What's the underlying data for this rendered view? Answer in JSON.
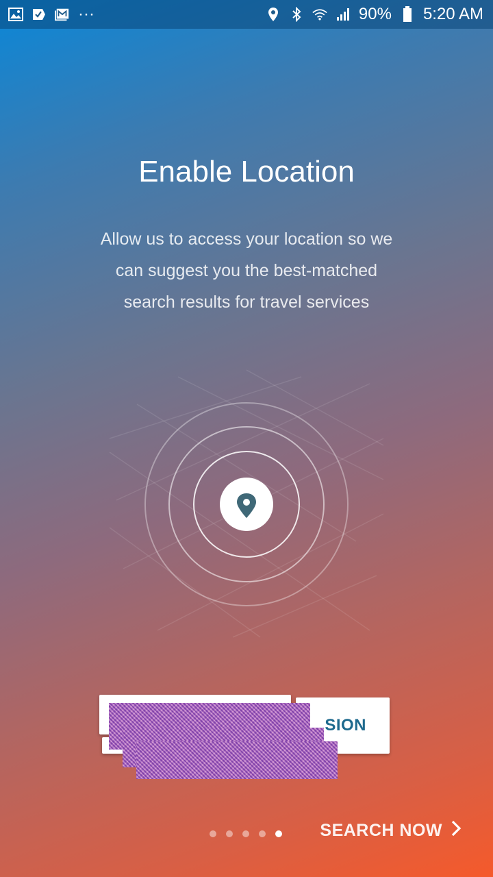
{
  "status_bar": {
    "left_icons": [
      "gallery-icon",
      "task-check-icon",
      "mail-icon",
      "more-dots-icon"
    ],
    "right_icons": [
      "location-icon",
      "bluetooth-icon",
      "wifi-icon",
      "signal-icon",
      "battery-icon"
    ],
    "battery": "90%",
    "time": "5:20 AM",
    "more": "···"
  },
  "onboarding": {
    "title": "Enable Location",
    "description_lines": [
      "Allow us to access your location so we",
      "can suggest you the best-matched",
      "search results for travel services"
    ],
    "center_icon": "map-pin-icon",
    "permission_button_label_partial": "SION"
  },
  "pager": {
    "count": 5,
    "active_index": 4
  },
  "footer": {
    "search_now_label": "SEARCH NOW",
    "chevron_icon": "chevron-right-icon"
  },
  "colors": {
    "gradient_top": "#0a87d8",
    "gradient_bottom": "#f55a2b",
    "pin_color": "#3f6877",
    "button_text": "#1e6a8e"
  }
}
